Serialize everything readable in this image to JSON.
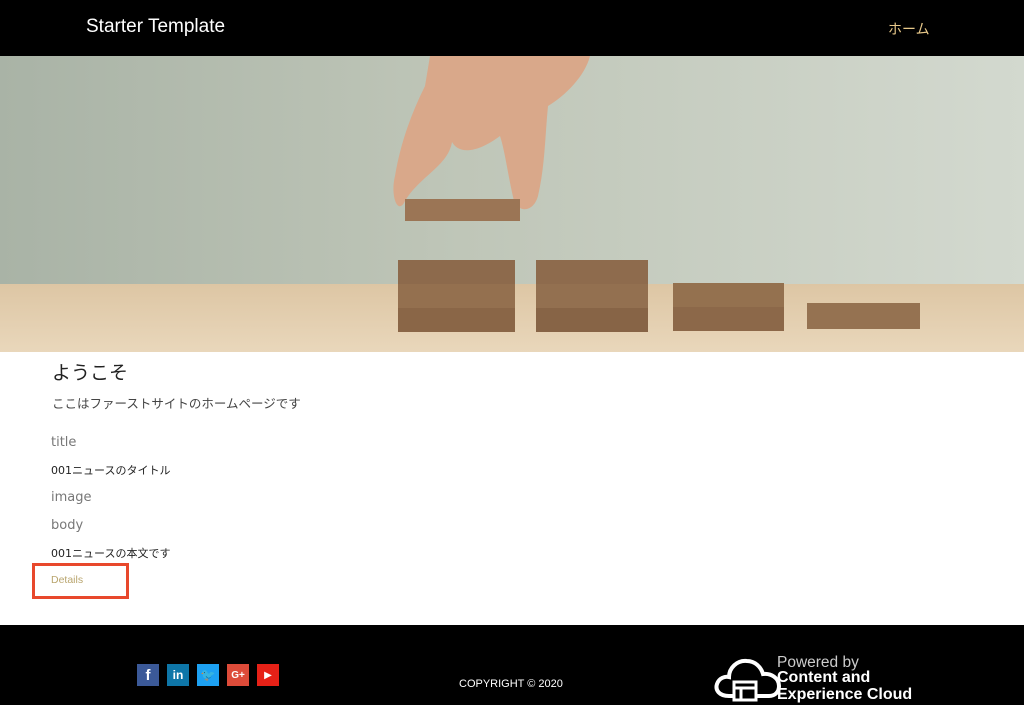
{
  "header": {
    "brand": "Starter Template",
    "nav": {
      "home_label": "ホーム"
    }
  },
  "hero": {
    "image_icon": "wooden-blocks-steps-image"
  },
  "main": {
    "welcome_title": "ようこそ",
    "welcome_description": "ここはファーストサイトのホームページです",
    "fields": {
      "title_label": "title",
      "title_value": "001ニュースのタイトル",
      "image_label": "image",
      "body_label": "body",
      "body_value": "001ニュースの本文です"
    },
    "details_label": "Details"
  },
  "footer": {
    "social": [
      {
        "icon": "facebook-icon",
        "glyph": "f",
        "color": "#3b5998"
      },
      {
        "icon": "linkedin-icon",
        "glyph": "in",
        "color": "#0e76a8"
      },
      {
        "icon": "twitter-icon",
        "glyph": "🐦",
        "color": "#1da1f2"
      },
      {
        "icon": "google-plus-icon",
        "glyph": "G+",
        "color": "#dd4b39"
      },
      {
        "icon": "youtube-icon",
        "glyph": "▶",
        "color": "#e62117"
      }
    ],
    "copyright": "COPYRIGHT © 2020",
    "powered_by": "Powered by",
    "powered_name": "Content and Experience Cloud"
  },
  "colors": {
    "header_bg": "#000000",
    "nav_accent": "#e8c98a",
    "details_link": "#b9a56e",
    "highlight_box": "#e8482c"
  }
}
